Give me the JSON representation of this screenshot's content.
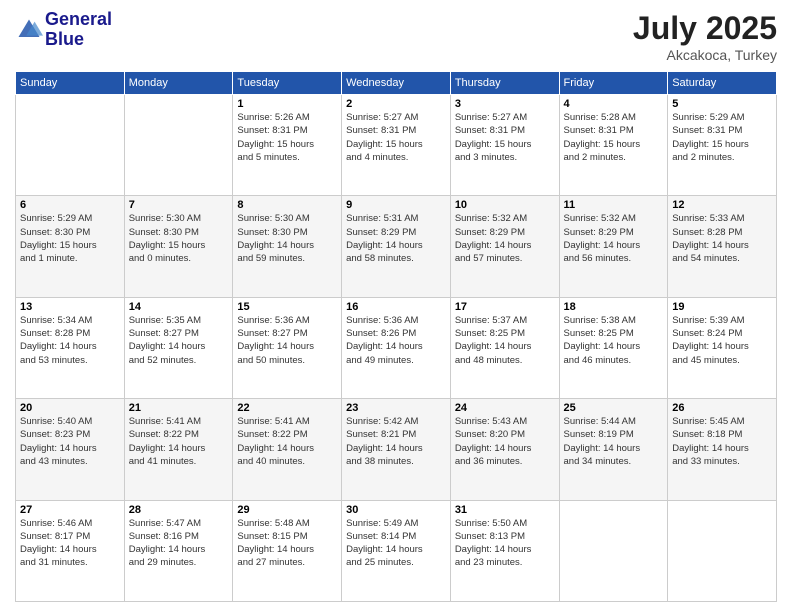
{
  "logo": {
    "line1": "General",
    "line2": "Blue"
  },
  "title": "July 2025",
  "location": "Akcakoca, Turkey",
  "days_header": [
    "Sunday",
    "Monday",
    "Tuesday",
    "Wednesday",
    "Thursday",
    "Friday",
    "Saturday"
  ],
  "weeks": [
    [
      {
        "day": "",
        "info": ""
      },
      {
        "day": "",
        "info": ""
      },
      {
        "day": "1",
        "info": "Sunrise: 5:26 AM\nSunset: 8:31 PM\nDaylight: 15 hours\nand 5 minutes."
      },
      {
        "day": "2",
        "info": "Sunrise: 5:27 AM\nSunset: 8:31 PM\nDaylight: 15 hours\nand 4 minutes."
      },
      {
        "day": "3",
        "info": "Sunrise: 5:27 AM\nSunset: 8:31 PM\nDaylight: 15 hours\nand 3 minutes."
      },
      {
        "day": "4",
        "info": "Sunrise: 5:28 AM\nSunset: 8:31 PM\nDaylight: 15 hours\nand 2 minutes."
      },
      {
        "day": "5",
        "info": "Sunrise: 5:29 AM\nSunset: 8:31 PM\nDaylight: 15 hours\nand 2 minutes."
      }
    ],
    [
      {
        "day": "6",
        "info": "Sunrise: 5:29 AM\nSunset: 8:30 PM\nDaylight: 15 hours\nand 1 minute."
      },
      {
        "day": "7",
        "info": "Sunrise: 5:30 AM\nSunset: 8:30 PM\nDaylight: 15 hours\nand 0 minutes."
      },
      {
        "day": "8",
        "info": "Sunrise: 5:30 AM\nSunset: 8:30 PM\nDaylight: 14 hours\nand 59 minutes."
      },
      {
        "day": "9",
        "info": "Sunrise: 5:31 AM\nSunset: 8:29 PM\nDaylight: 14 hours\nand 58 minutes."
      },
      {
        "day": "10",
        "info": "Sunrise: 5:32 AM\nSunset: 8:29 PM\nDaylight: 14 hours\nand 57 minutes."
      },
      {
        "day": "11",
        "info": "Sunrise: 5:32 AM\nSunset: 8:29 PM\nDaylight: 14 hours\nand 56 minutes."
      },
      {
        "day": "12",
        "info": "Sunrise: 5:33 AM\nSunset: 8:28 PM\nDaylight: 14 hours\nand 54 minutes."
      }
    ],
    [
      {
        "day": "13",
        "info": "Sunrise: 5:34 AM\nSunset: 8:28 PM\nDaylight: 14 hours\nand 53 minutes."
      },
      {
        "day": "14",
        "info": "Sunrise: 5:35 AM\nSunset: 8:27 PM\nDaylight: 14 hours\nand 52 minutes."
      },
      {
        "day": "15",
        "info": "Sunrise: 5:36 AM\nSunset: 8:27 PM\nDaylight: 14 hours\nand 50 minutes."
      },
      {
        "day": "16",
        "info": "Sunrise: 5:36 AM\nSunset: 8:26 PM\nDaylight: 14 hours\nand 49 minutes."
      },
      {
        "day": "17",
        "info": "Sunrise: 5:37 AM\nSunset: 8:25 PM\nDaylight: 14 hours\nand 48 minutes."
      },
      {
        "day": "18",
        "info": "Sunrise: 5:38 AM\nSunset: 8:25 PM\nDaylight: 14 hours\nand 46 minutes."
      },
      {
        "day": "19",
        "info": "Sunrise: 5:39 AM\nSunset: 8:24 PM\nDaylight: 14 hours\nand 45 minutes."
      }
    ],
    [
      {
        "day": "20",
        "info": "Sunrise: 5:40 AM\nSunset: 8:23 PM\nDaylight: 14 hours\nand 43 minutes."
      },
      {
        "day": "21",
        "info": "Sunrise: 5:41 AM\nSunset: 8:22 PM\nDaylight: 14 hours\nand 41 minutes."
      },
      {
        "day": "22",
        "info": "Sunrise: 5:41 AM\nSunset: 8:22 PM\nDaylight: 14 hours\nand 40 minutes."
      },
      {
        "day": "23",
        "info": "Sunrise: 5:42 AM\nSunset: 8:21 PM\nDaylight: 14 hours\nand 38 minutes."
      },
      {
        "day": "24",
        "info": "Sunrise: 5:43 AM\nSunset: 8:20 PM\nDaylight: 14 hours\nand 36 minutes."
      },
      {
        "day": "25",
        "info": "Sunrise: 5:44 AM\nSunset: 8:19 PM\nDaylight: 14 hours\nand 34 minutes."
      },
      {
        "day": "26",
        "info": "Sunrise: 5:45 AM\nSunset: 8:18 PM\nDaylight: 14 hours\nand 33 minutes."
      }
    ],
    [
      {
        "day": "27",
        "info": "Sunrise: 5:46 AM\nSunset: 8:17 PM\nDaylight: 14 hours\nand 31 minutes."
      },
      {
        "day": "28",
        "info": "Sunrise: 5:47 AM\nSunset: 8:16 PM\nDaylight: 14 hours\nand 29 minutes."
      },
      {
        "day": "29",
        "info": "Sunrise: 5:48 AM\nSunset: 8:15 PM\nDaylight: 14 hours\nand 27 minutes."
      },
      {
        "day": "30",
        "info": "Sunrise: 5:49 AM\nSunset: 8:14 PM\nDaylight: 14 hours\nand 25 minutes."
      },
      {
        "day": "31",
        "info": "Sunrise: 5:50 AM\nSunset: 8:13 PM\nDaylight: 14 hours\nand 23 minutes."
      },
      {
        "day": "",
        "info": ""
      },
      {
        "day": "",
        "info": ""
      }
    ]
  ]
}
